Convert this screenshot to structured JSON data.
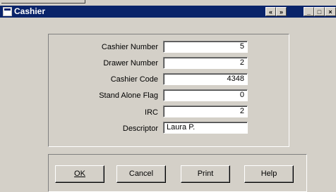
{
  "window": {
    "title": "Cashier"
  },
  "titlebar": {
    "nav_prev": "«",
    "nav_next": "»",
    "min": "_",
    "max": "□",
    "close": "×"
  },
  "fields": [
    {
      "label": "Cashier Number",
      "value": "5"
    },
    {
      "label": "Drawer Number",
      "value": "2"
    },
    {
      "label": "Cashier Code",
      "value": "4348"
    },
    {
      "label": "Stand Alone Flag",
      "value": "0"
    },
    {
      "label": "IRC",
      "value": "2"
    },
    {
      "label": "Descriptor",
      "value": "Laura P."
    }
  ],
  "buttons": {
    "ok": "OK",
    "cancel": "Cancel",
    "print": "Print",
    "help": "Help"
  },
  "colors": {
    "titlebar": "#0a246a",
    "face": "#d4d0c8"
  }
}
